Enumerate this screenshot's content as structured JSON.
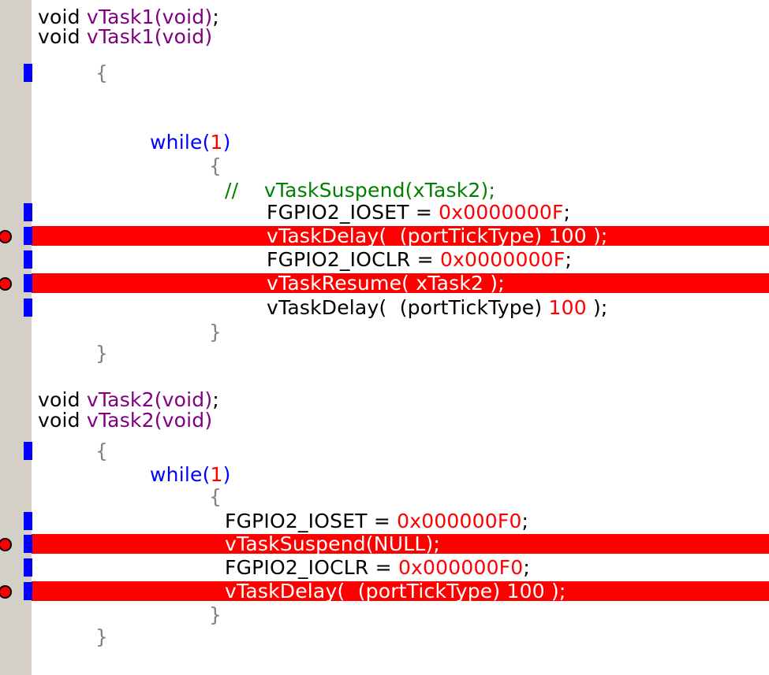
{
  "colors": {
    "gutter": "#d4d0c8",
    "breakpoint_line": "#ff0000",
    "exec_marker": "#0000ff",
    "keyword": "#0000ff",
    "type": "#800080",
    "number": "#ff0000",
    "comment": "#008000"
  },
  "lines": [
    {
      "id": "l0",
      "text": "void vTask1(void);"
    },
    {
      "id": "l1",
      "text": "void vTask1(void)"
    },
    {
      "id": "l2",
      "text": "{"
    },
    {
      "id": "l3",
      "text": "while(1)"
    },
    {
      "id": "l4",
      "text": "{"
    },
    {
      "id": "l5",
      "text": "//    vTaskSuspend(xTask2);"
    },
    {
      "id": "l6",
      "text": "FGPIO2_IOSET = 0x0000000F;"
    },
    {
      "id": "l7",
      "text": "vTaskDelay(  (portTickType) 100 );"
    },
    {
      "id": "l8",
      "text": "FGPIO2_IOCLR = 0x0000000F;"
    },
    {
      "id": "l9",
      "text": "vTaskResume( xTask2 );"
    },
    {
      "id": "l10",
      "text": "vTaskDelay(  (portTickType) 100 );"
    },
    {
      "id": "l11",
      "text": "}"
    },
    {
      "id": "l12",
      "text": "}"
    },
    {
      "id": "l13",
      "text": "void vTask2(void);"
    },
    {
      "id": "l14",
      "text": "void vTask2(void)"
    },
    {
      "id": "l15",
      "text": "{"
    },
    {
      "id": "l16",
      "text": "while(1)"
    },
    {
      "id": "l17",
      "text": "{"
    },
    {
      "id": "l18",
      "text": "FGPIO2_IOSET = 0x000000F0;"
    },
    {
      "id": "l19",
      "text": "vTaskSuspend(NULL);"
    },
    {
      "id": "l20",
      "text": "FGPIO2_IOCLR = 0x000000F0;"
    },
    {
      "id": "l21",
      "text": "vTaskDelay(  (portTickType) 100 );"
    },
    {
      "id": "l22",
      "text": "}"
    },
    {
      "id": "l23",
      "text": "}"
    }
  ]
}
